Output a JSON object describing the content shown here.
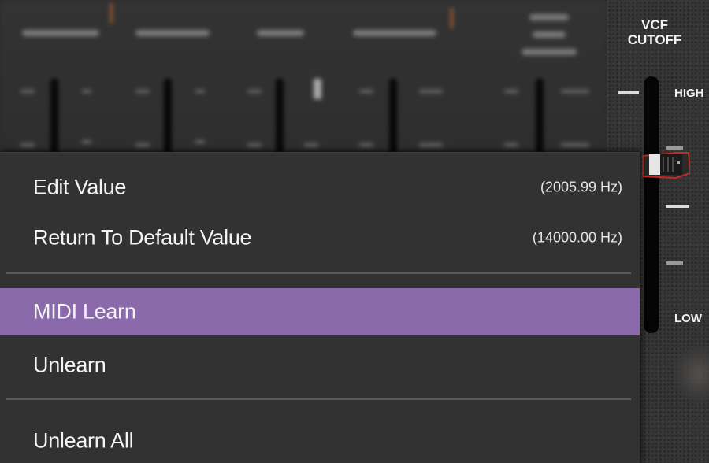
{
  "background_panel": {
    "vcf_title": "VCF\nCUTOFF",
    "vcf_high_label": "HIGH",
    "vcf_low_label": "LOW"
  },
  "context_menu": {
    "items": [
      {
        "label": "Edit Value",
        "value": "(2005.99 Hz)",
        "highlighted": false
      },
      {
        "label": "Return To Default Value",
        "value": "(14000.00 Hz)",
        "highlighted": false
      },
      {
        "label": "MIDI Learn",
        "value": "",
        "highlighted": true
      },
      {
        "label": "Unlearn",
        "value": "",
        "highlighted": false
      },
      {
        "label": "Unlearn All",
        "value": "",
        "highlighted": false
      }
    ]
  },
  "colors": {
    "menu_background": "#323232",
    "highlight": "#8a6aaa",
    "separator": "#5c5c5c",
    "text": "#f4f4f4",
    "slider_outline": "#c62828"
  },
  "icons": [
    "vcf-cutoff-slider-thumb"
  ]
}
